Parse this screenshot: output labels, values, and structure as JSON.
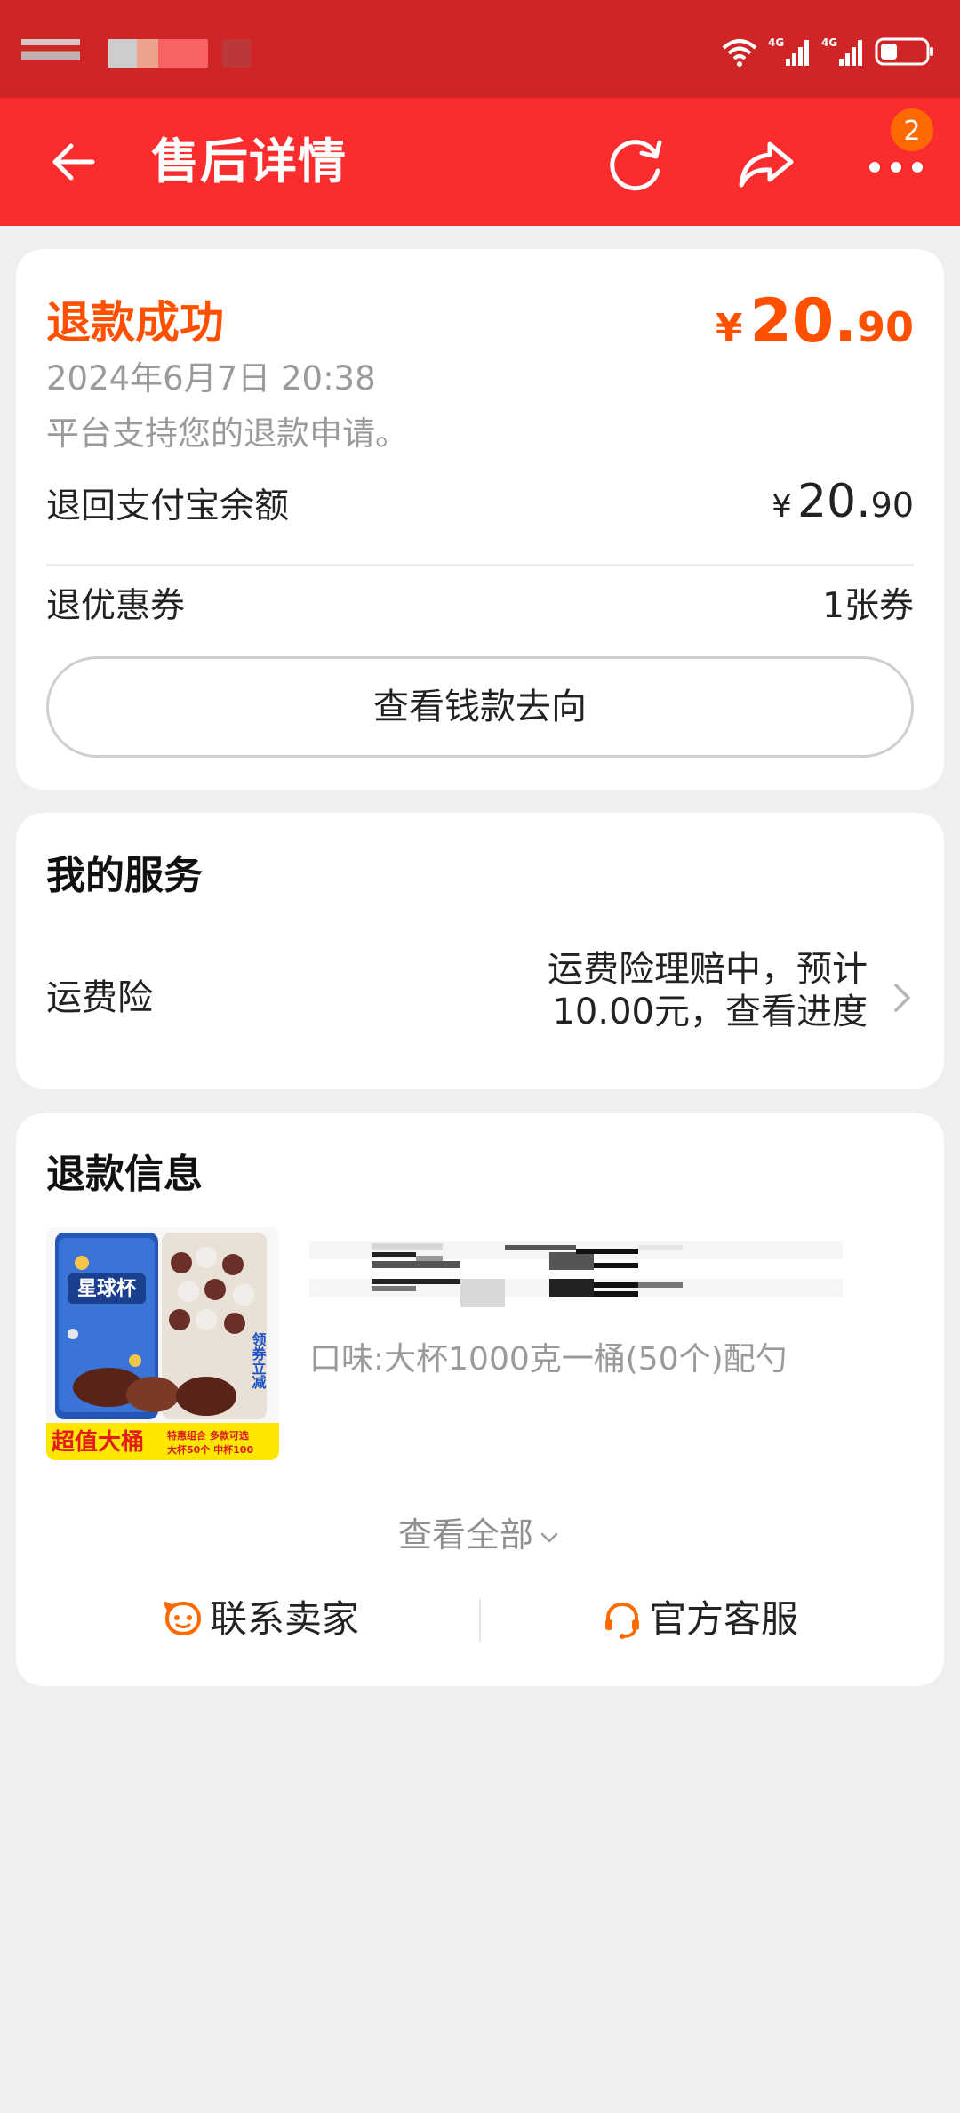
{
  "header": {
    "title": "售后详情",
    "badge_count": "2"
  },
  "refund": {
    "status": "退款成功",
    "amount_currency": "¥",
    "amount_int": "20.",
    "amount_dec": "90",
    "date": "2024年6月7日 20:38",
    "note": "平台支持您的退款申请。",
    "alipay_label": "退回支付宝余额",
    "alipay_currency": "¥",
    "alipay_int": "20.",
    "alipay_dec": "90",
    "coupon_label": "退优惠券",
    "coupon_value": "1张券",
    "money_button": "查看钱款去向"
  },
  "service": {
    "title": "我的服务",
    "insurance_label": "运费险",
    "insurance_value": "运费险理赔中，预计10.00元，查看进度"
  },
  "refund_info": {
    "title": "退款信息",
    "flavor": "口味:大杯1000克一桶(50个)配勺",
    "product_image_text": {
      "brand": "星球杯",
      "left_tag": "超值大桶",
      "right_tag": "领券立减",
      "promo1": "特惠组合 多款可选",
      "promo2": "大杯50个 中杯100"
    },
    "view_all": "查看全部",
    "contact_seller": "联系卖家",
    "official_service": "官方客服"
  },
  "colors": {
    "header_bg": "#fb2c2d",
    "statusbar_bg": "#cf2526",
    "accent_orange": "#ff5000"
  }
}
